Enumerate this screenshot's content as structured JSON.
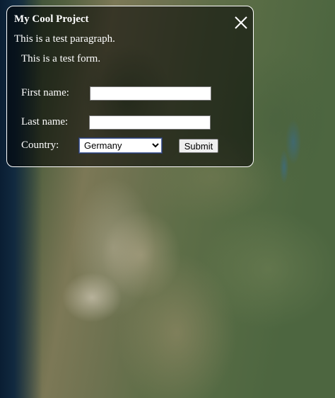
{
  "popup": {
    "title": "My Cool Project",
    "close_icon": "close-x-icon",
    "paragraph": "This is a test paragraph."
  },
  "form": {
    "intro": "This is a test form.",
    "first_name_label": "First name:",
    "first_name_value": "",
    "last_name_label": "Last name:",
    "last_name_value": "",
    "country_label": "Country:",
    "country_selected": "Germany",
    "submit_label": "Submit"
  },
  "colors": {
    "panel_border": "#ffffff",
    "panel_text": "#ffffff"
  }
}
